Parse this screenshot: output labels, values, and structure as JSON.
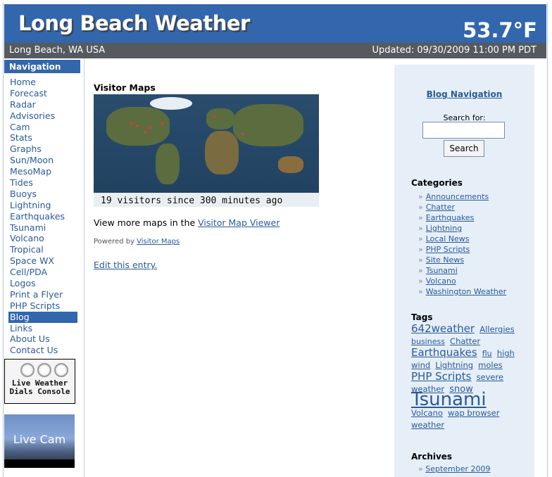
{
  "header": {
    "site_title": "Long Beach Weather",
    "temperature": "53.7°F"
  },
  "subbar": {
    "location": "Long Beach, WA USA",
    "updated": "Updated: 09/30/2009 11:00 PM PDT"
  },
  "sidebar": {
    "heading": "Navigation",
    "items": [
      "Home",
      "Forecast",
      "Radar",
      "Advisories",
      "Cam",
      "Stats",
      "Graphs",
      "Sun/Moon",
      "MesoMap",
      "Tides",
      "Buoys",
      "Lightning",
      "Earthquakes",
      "Tsunami",
      "Volcano",
      "Tropical",
      "Space WX",
      "Cell/PDA",
      "Logos",
      "Print a Flyer",
      "PHP Scripts",
      "Blog",
      "Links",
      "About Us",
      "Contact Us"
    ],
    "active_item": "Blog",
    "dials_banner": [
      "Live Weather",
      "Dials Console"
    ],
    "cam_banner": "Live Cam"
  },
  "main": {
    "heading": "Visitor Maps",
    "map_caption": "19 visitors since 300 minutes ago",
    "more_prefix": "View more maps in the ",
    "more_link": "Visitor Map Viewer",
    "powered_prefix": "Powered by ",
    "powered_link": "Visitor Maps",
    "edit_link": "Edit this entry."
  },
  "right": {
    "blog_nav": "Blog Navigation",
    "search_label": "Search for:",
    "search_value": "",
    "search_button": "Search",
    "categories_heading": "Categories",
    "categories": [
      "Announcements",
      "Chatter",
      "Earthquakes",
      "Lightning",
      "Local News",
      "PHP Scripts",
      "Site News",
      "Tsunami",
      "Volcano",
      "Washington Weather"
    ],
    "tags_heading": "Tags",
    "tags": [
      {
        "t": "642weather",
        "size": 15
      },
      {
        "t": "Allergies",
        "size": 11.5
      },
      {
        "t": "business",
        "size": 11
      },
      {
        "t": "Chatter",
        "size": 11.5
      },
      {
        "t": "Earthquakes",
        "size": 15
      },
      {
        "t": "flu",
        "size": 11
      },
      {
        "t": "high wind",
        "size": 11.5
      },
      {
        "t": "Lightning",
        "size": 11.5
      },
      {
        "t": "moles",
        "size": 11.5
      },
      {
        "t": "PHP Scripts",
        "size": 15
      },
      {
        "t": "severe weather",
        "size": 11.5
      },
      {
        "t": "snow",
        "size": 13
      },
      {
        "t": "Tsunami",
        "size": 26
      },
      {
        "t": "Volcano",
        "size": 11.5
      },
      {
        "t": "wap browser",
        "size": 11.5
      },
      {
        "t": "weather",
        "size": 11.5
      }
    ],
    "archives_heading": "Archives",
    "archives": [
      "September 2009"
    ]
  }
}
